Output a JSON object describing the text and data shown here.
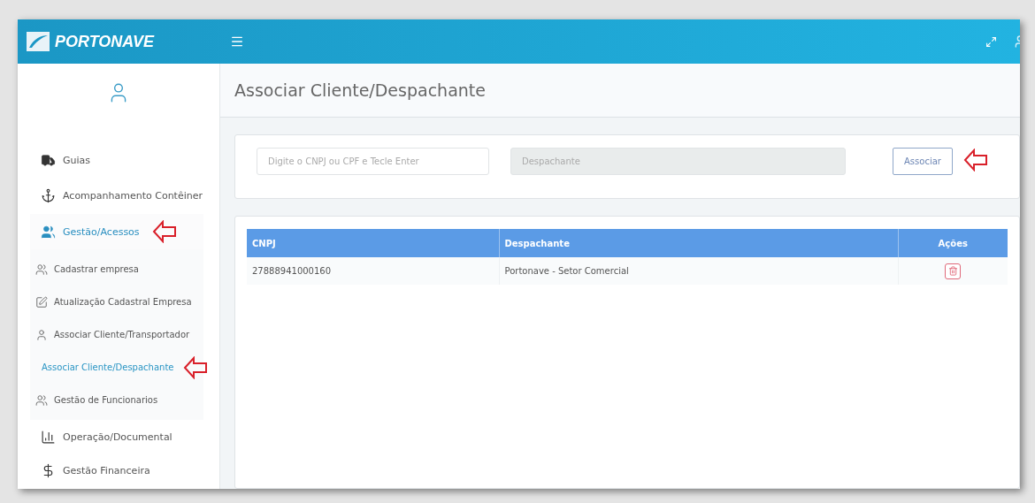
{
  "topbar": {
    "logo_text": "PORTONAVE"
  },
  "sidebar": {
    "items": [
      {
        "label": "Guias",
        "selected": false,
        "marked": false
      },
      {
        "label": "Acompanhamento Contêiner",
        "selected": false,
        "marked": false
      },
      {
        "label": "Gestão/Acessos",
        "selected": true,
        "marked": true,
        "expanded": true,
        "children": [
          {
            "label": "Cadastrar empresa",
            "selected": false,
            "marked": false
          },
          {
            "label": "Atualização Cadastral Empresa",
            "selected": false,
            "marked": false
          },
          {
            "label": "Associar Cliente/Transportador",
            "selected": false,
            "marked": false
          },
          {
            "label": "Associar Cliente/Despachante",
            "selected": true,
            "marked": true
          },
          {
            "label": "Gestão de Funcionarios",
            "selected": false,
            "marked": false
          }
        ]
      },
      {
        "label": "Operação/Documental",
        "selected": false,
        "marked": false
      },
      {
        "label": "Gestão Financeira",
        "selected": false,
        "marked": false
      }
    ]
  },
  "page_title": "Associar Cliente/Despachante",
  "form": {
    "search": {
      "placeholder": "Digite o CNPJ ou CPF e Tecle Enter"
    },
    "despachante": {
      "placeholder": "Despachante",
      "disabled": true
    },
    "button": {
      "label": "Associar",
      "marked": true
    }
  },
  "table": {
    "columns": [
      "CNPJ",
      "Despachante",
      "Ações"
    ],
    "rows": [
      {
        "cnpj": "27888941000160",
        "despachante": "Portonave - Setor Comercial"
      }
    ]
  }
}
